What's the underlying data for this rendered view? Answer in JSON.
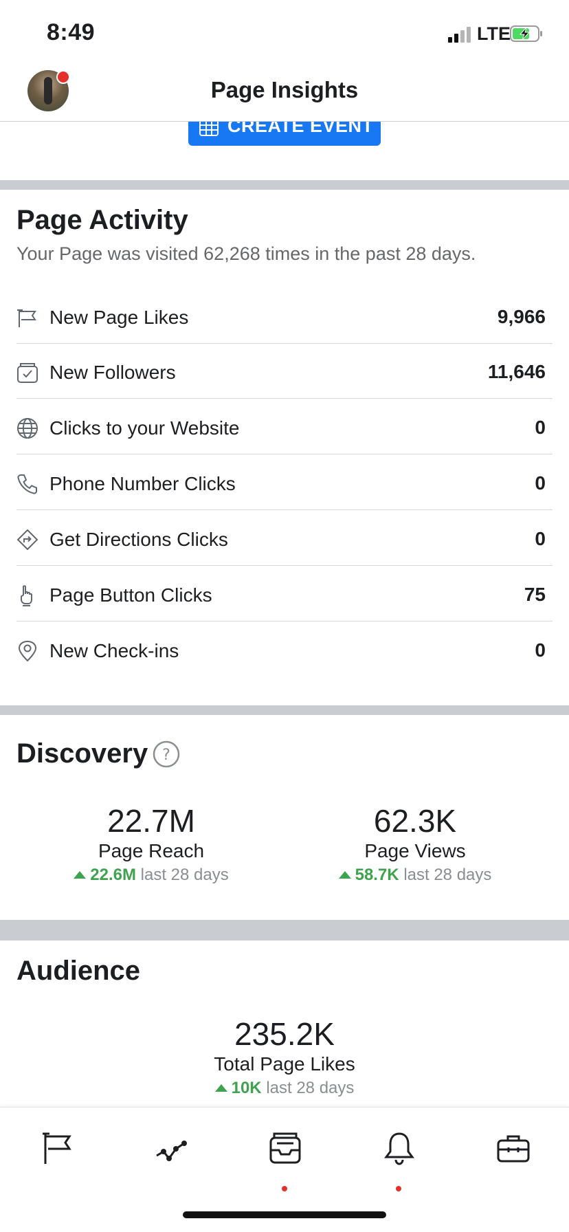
{
  "status_bar": {
    "time": "8:49",
    "network": "LTE"
  },
  "nav": {
    "title": "Page Insights"
  },
  "create_event": {
    "label": "CREATE EVENT"
  },
  "page_activity": {
    "title": "Page Activity",
    "subtitle": "Your Page was visited 62,268 times in the past 28 days.",
    "rows": [
      {
        "label": "New Page Likes",
        "value": "9,966",
        "icon": "flag-icon"
      },
      {
        "label": "New Followers",
        "value": "11,646",
        "icon": "follow-inbox-icon"
      },
      {
        "label": "Clicks to your Website",
        "value": "0",
        "icon": "globe-icon"
      },
      {
        "label": "Phone Number Clicks",
        "value": "0",
        "icon": "phone-icon"
      },
      {
        "label": "Get Directions Clicks",
        "value": "0",
        "icon": "directions-icon"
      },
      {
        "label": "Page Button Clicks",
        "value": "75",
        "icon": "pointer-hand-icon"
      },
      {
        "label": "New Check-ins",
        "value": "0",
        "icon": "location-pin-icon"
      }
    ]
  },
  "discovery": {
    "title": "Discovery",
    "help_symbol": "?",
    "stats": [
      {
        "value": "22.7M",
        "label": "Page Reach",
        "change": "22.6M",
        "period": "last 28 days"
      },
      {
        "value": "62.3K",
        "label": "Page Views",
        "change": "58.7K",
        "period": "last 28 days"
      }
    ]
  },
  "audience": {
    "title": "Audience",
    "stat": {
      "value": "235.2K",
      "label": "Total Page Likes",
      "change": "10K",
      "period": "last 28 days"
    }
  },
  "tabs": [
    {
      "name": "pages",
      "icon": "flag-icon",
      "badge": false
    },
    {
      "name": "insights",
      "icon": "trend-line-icon",
      "badge": false
    },
    {
      "name": "inbox",
      "icon": "inbox-icon",
      "badge": true
    },
    {
      "name": "notifications",
      "icon": "bell-icon",
      "badge": true
    },
    {
      "name": "tools",
      "icon": "briefcase-icon",
      "badge": false
    }
  ],
  "colors": {
    "accent": "#1877f2",
    "positive": "#3fa24e",
    "badge": "#e4322b",
    "separator": "#c9ccd1"
  }
}
